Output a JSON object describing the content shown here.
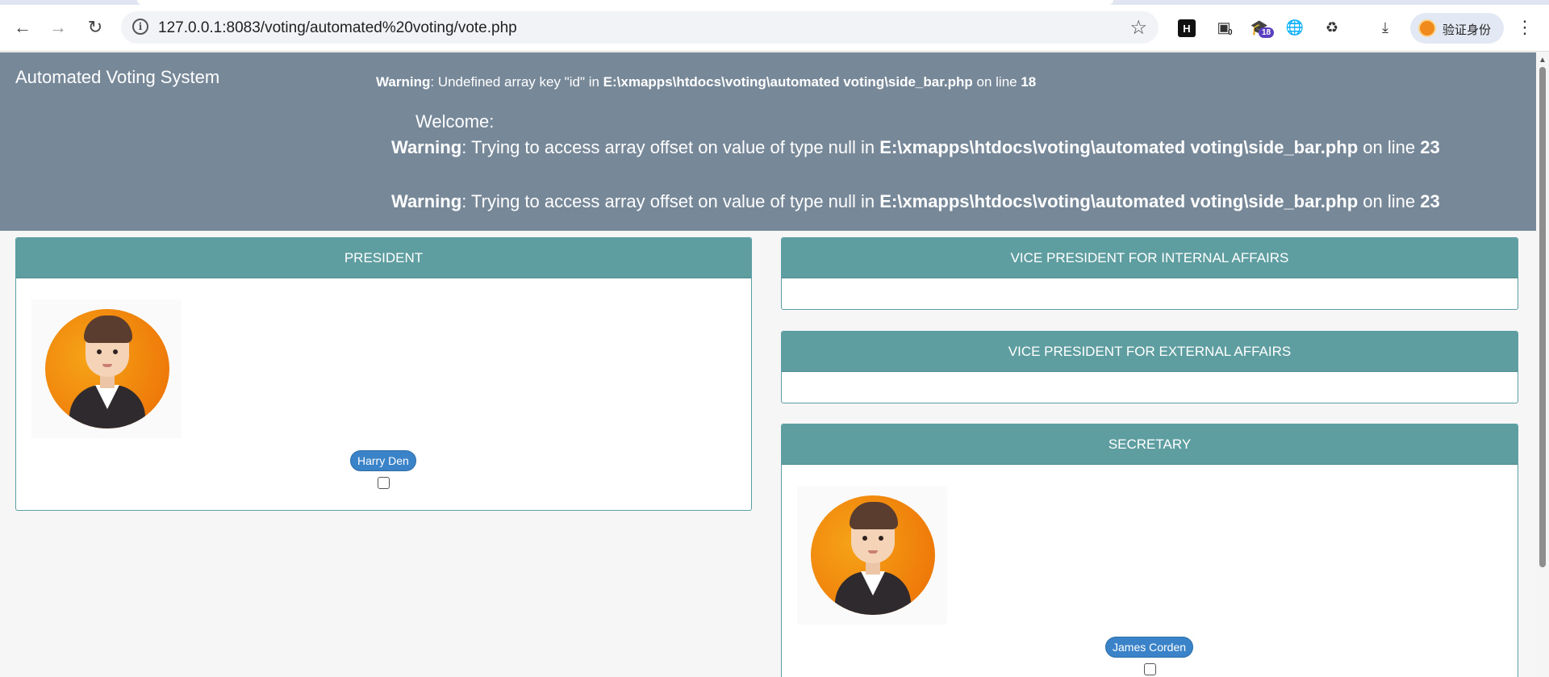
{
  "browser": {
    "url": "127.0.0.1:8083/voting/automated%20voting/vote.php",
    "profile_label": "验证身份",
    "ext_badge_0": "0",
    "ext_badge_18": "18",
    "ext_h_label": "H"
  },
  "header": {
    "app_title": "Automated Voting System",
    "warning1": {
      "prefix": "Warning",
      "text": ": Undefined array key \"id\" in ",
      "path": "E:\\xmapps\\htdocs\\voting\\automated voting\\side_bar.php",
      "mid": " on line ",
      "line": "18"
    },
    "welcome": "Welcome:",
    "warning2": {
      "prefix": "Warning",
      "text": ": Trying to access array offset on value of type null in ",
      "path": "E:\\xmapps\\htdocs\\voting\\automated voting\\side_bar.php",
      "mid": " on line ",
      "line": "23"
    },
    "warning3": {
      "prefix": "Warning",
      "text": ": Trying to access array offset on value of type null in ",
      "path": "E:\\xmapps\\htdocs\\voting\\automated voting\\side_bar.php",
      "mid": " on line ",
      "line": "23"
    }
  },
  "positions": [
    {
      "title": "PRESIDENT",
      "candidate": "Harry Den"
    },
    {
      "title": "VICE PRESIDENT FOR INTERNAL AFFAIRS"
    },
    {
      "title": "VICE PRESIDENT FOR EXTERNAL AFFAIRS"
    },
    {
      "title": "SECRETARY",
      "candidate": "James Corden"
    }
  ],
  "colors": {
    "header_bg": "#778899",
    "panel_head_bg": "#5f9ea0",
    "candidate_badge": "#3b83c8"
  }
}
